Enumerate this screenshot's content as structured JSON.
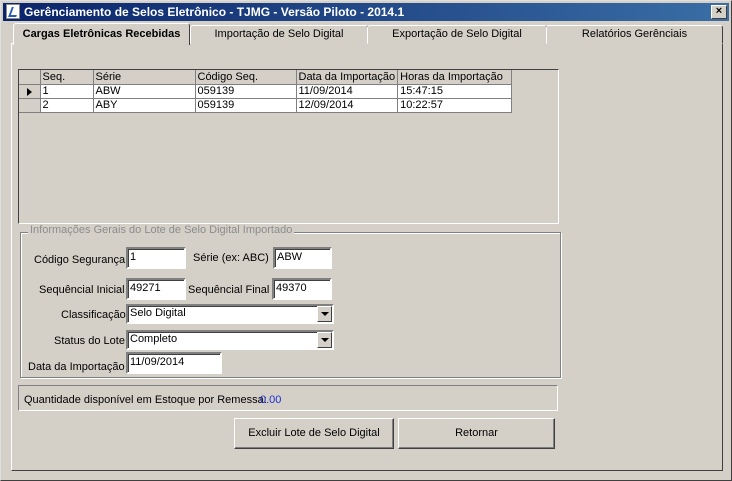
{
  "window": {
    "title": "Gerênciamento de Selos Eletrônico - TJMG  - Versão Piloto - 2014.1",
    "close_label": "×"
  },
  "tabs": [
    {
      "label": "Cargas Eletrônicas Recebidas",
      "active": true
    },
    {
      "label": "Importação de Selo Digital",
      "active": false
    },
    {
      "label": "Exportação de Selo Digital",
      "active": false
    },
    {
      "label": "Relatórios Gerênciais",
      "active": false
    }
  ],
  "grid": {
    "columns": [
      "Seq.",
      "Série",
      "Código Seq.",
      "Data da Importação",
      "Horas da Importação"
    ],
    "rows": [
      [
        "1",
        "ABW",
        "059139",
        "11/09/2014",
        "15:47:15"
      ],
      [
        "2",
        "ABY",
        "059139",
        "12/09/2014",
        "10:22:57"
      ]
    ],
    "selected_row": 0
  },
  "info": {
    "legend": "Informações Gerais do Lote de Selo Digital Importado",
    "codigo_seguranca_label": "Código Segurança",
    "codigo_seguranca_value": "1",
    "serie_label": "Série (ex: ABC)",
    "serie_value": "ABW",
    "sequencial_inicial_label": "Sequêncial Inicial",
    "sequencial_inicial_value": "49271",
    "sequencial_final_label": "Sequêncial  Final",
    "sequencial_final_value": "49370",
    "classificacao_label": "Classificação",
    "classificacao_value": "Selo Digital",
    "status_label": "Status do Lote",
    "status_value": "Completo",
    "data_importacao_label": "Data da Importação",
    "data_importacao_value": "11/09/2014"
  },
  "quantity": {
    "label": "Quantidade disponível em Estoque por Remessa:",
    "value": "0.00",
    "value_color": "#1c2fd1"
  },
  "buttons": {
    "excluir": "Excluir Lote de Selo Digital",
    "retornar": "Retornar"
  }
}
